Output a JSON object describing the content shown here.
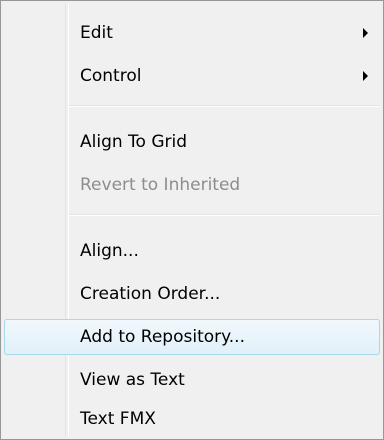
{
  "context_menu": {
    "items": [
      {
        "label": "Edit",
        "has_submenu": true
      },
      {
        "label": "Control",
        "has_submenu": true
      },
      {
        "label": "Align To Grid"
      },
      {
        "label": "Revert to Inherited",
        "disabled": true
      },
      {
        "label": "Align..."
      },
      {
        "label": "Creation Order..."
      },
      {
        "label": "Add to Repository...",
        "highlighted": true
      },
      {
        "label": "View as Text"
      },
      {
        "label": "Text FMX"
      }
    ],
    "submenu_arrow_icon": "triangle-right-icon",
    "colors": {
      "background": "#f0f0f0",
      "border": "#979797",
      "highlight_border": "#a8d8eb",
      "highlight_fill": "#e1f0fa",
      "disabled_text": "#8d8d8d"
    }
  }
}
